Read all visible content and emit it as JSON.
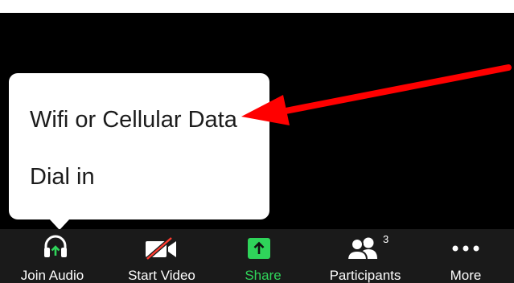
{
  "audio_menu": {
    "items": [
      {
        "label": "Wifi or Cellular Data"
      },
      {
        "label": "Dial in"
      }
    ]
  },
  "toolbar": {
    "join_audio": {
      "label": "Join Audio",
      "icon": "headphones-upload-icon"
    },
    "start_video": {
      "label": "Start Video",
      "icon": "video-off-icon"
    },
    "share": {
      "label": "Share",
      "icon": "share-upload-icon"
    },
    "participants": {
      "label": "Participants",
      "icon": "participants-icon",
      "count": "3"
    },
    "more": {
      "label": "More",
      "icon": "more-dots-icon"
    }
  },
  "colors": {
    "background": "#000000",
    "toolbar": "#1a1a1a",
    "menu": "#ffffff",
    "share_green": "#2fd45a",
    "annotation_arrow": "#ff0000",
    "video_off_slash": "#ff3b30"
  }
}
